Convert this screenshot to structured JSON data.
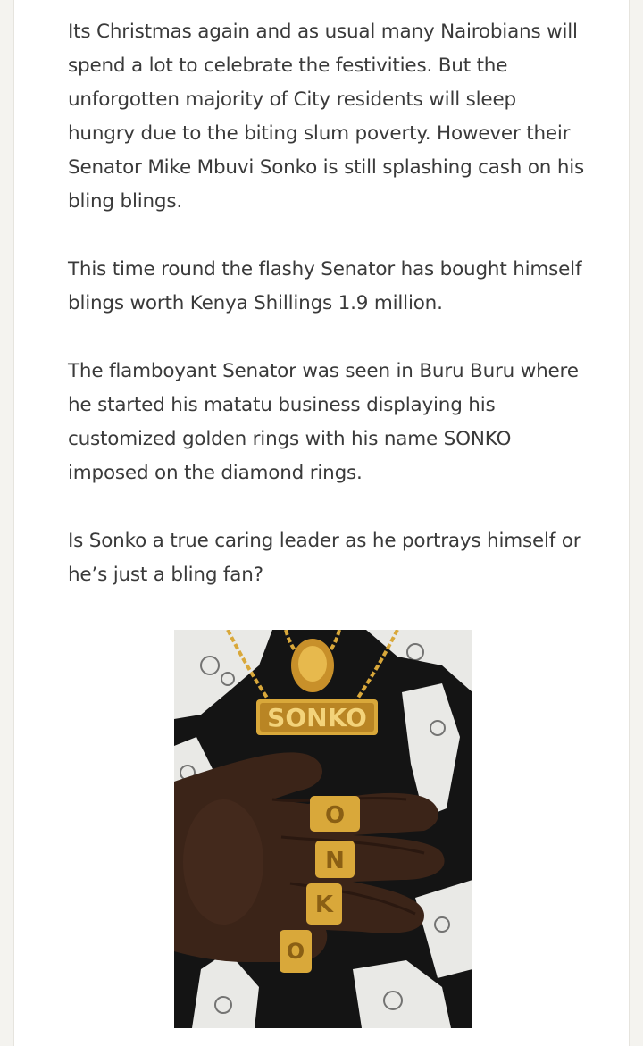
{
  "article": {
    "paragraphs": [
      "Its Christmas again and as usual many Nairobians will spend a lot to celebrate the festivities. But the unforgotten majority of City residents will sleep hungry due to the biting slum poverty. However their Senator Mike Mbuvi Sonko is still splashing cash on his bling blings.",
      "This time round the flashy Senator has bought himself blings worth Kenya Shillings 1.9 million.",
      "The flamboyant Senator was seen in Buru Buru where he started his matatu business displaying his customized golden rings with his name SONKO imposed on the diamond rings.",
      "Is Sonko a true caring leader as he portrays himself or he’s just a bling fan?"
    ],
    "photo": {
      "pendant_text": "SONKO",
      "ring_letters": [
        "O",
        "N",
        "K",
        "O"
      ],
      "colors": {
        "gold": "#d9a83a",
        "skin": "#3b2418",
        "shirt": "#141414",
        "print": "#e9e9e6"
      }
    }
  }
}
